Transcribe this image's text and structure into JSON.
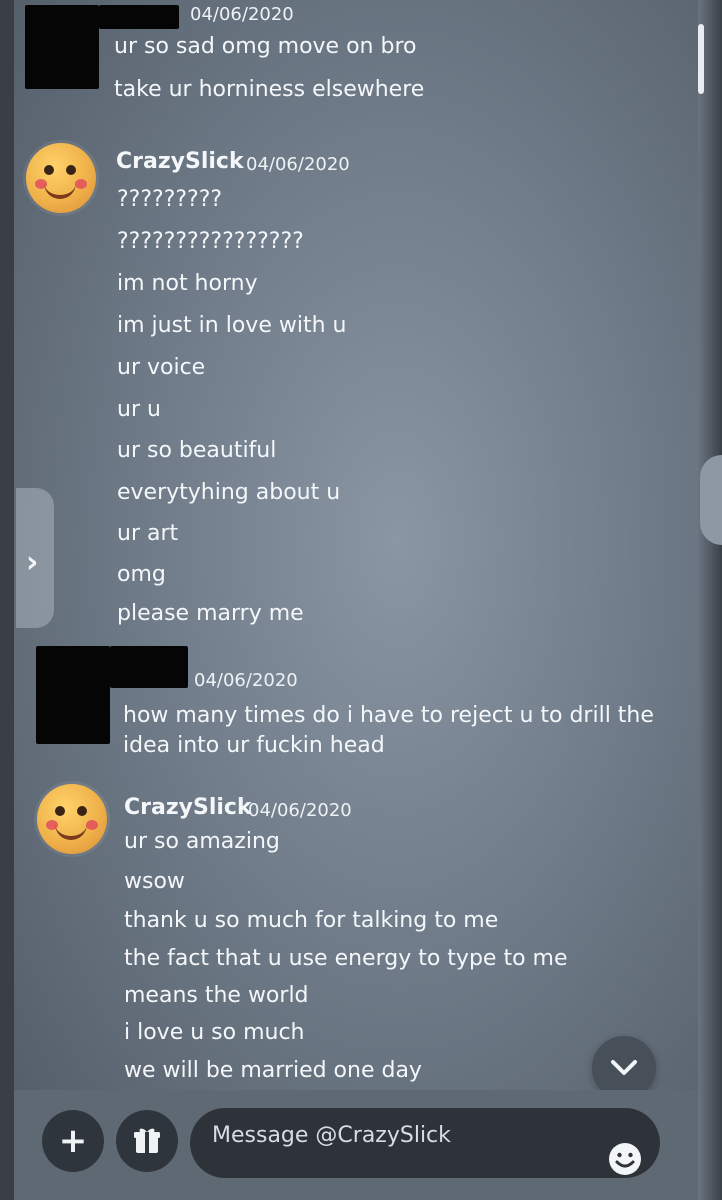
{
  "conversation": {
    "messages": [
      {
        "author_redacted": true,
        "timestamp": "04/06/2020",
        "lines": [
          "ur so sad omg move on bro",
          "take ur horniness elsewhere"
        ]
      },
      {
        "author": "CrazySlick",
        "timestamp": "04/06/2020",
        "lines": [
          "?????????",
          "????????????????",
          "im not horny",
          "im just in love with u",
          "ur voice",
          "ur u",
          "ur so beautiful",
          "everytyhing about u",
          "ur art",
          "omg",
          "please marry me"
        ]
      },
      {
        "author_redacted": true,
        "timestamp": "04/06/2020",
        "lines": [
          "how many times do i have to reject u to drill the",
          "idea into ur fuckin head"
        ]
      },
      {
        "author": "CrazySlick",
        "timestamp": "04/06/2020",
        "lines": [
          "ur so amazing",
          "wsow",
          "thank u so much for talking to me",
          "the fact that u use energy to type to me",
          "means the world",
          "i love u so much",
          "we will be married one day"
        ]
      }
    ]
  },
  "composer": {
    "placeholder": "Message @CrazySlick"
  },
  "icons": {
    "plus": "plus-icon",
    "gift": "gift-icon",
    "emoji": "emoji-icon",
    "jump": "chevron-down-icon",
    "drawer": "chevron-right-icon"
  },
  "colors": {
    "background": "#6f7b88",
    "text": "#f4f7fa",
    "redaction": "#050505",
    "input_background": "#2e3339"
  }
}
